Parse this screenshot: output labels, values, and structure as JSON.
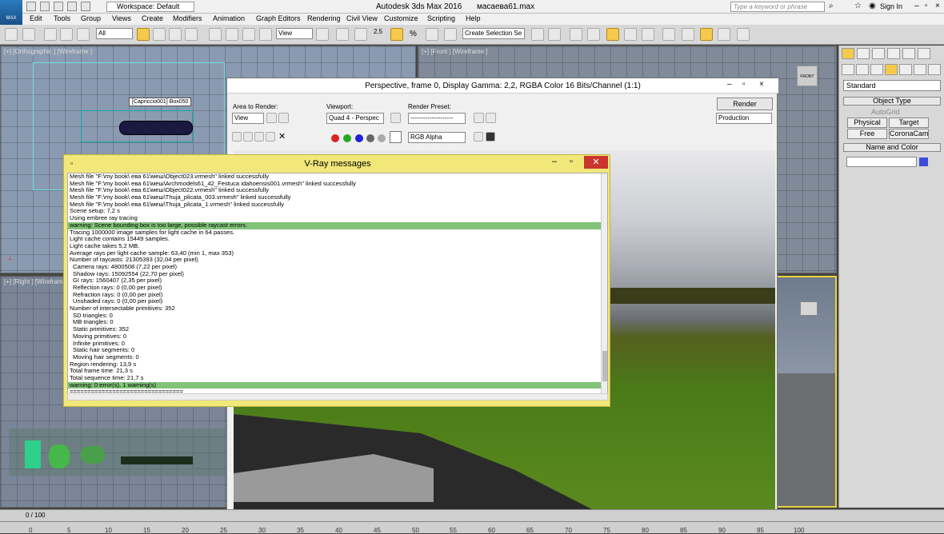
{
  "app": {
    "title": "Autodesk 3ds Max 2016",
    "filename": "масаева61.max",
    "workspace": "Workspace: Default",
    "search_placeholder": "Type a keyword or phrase",
    "sign_in": "Sign In",
    "logo_text": "MAX"
  },
  "menu": [
    "Edit",
    "Tools",
    "Group",
    "Views",
    "Create",
    "Modifiers",
    "Animation",
    "Graph Editors",
    "Rendering",
    "Civil View",
    "Customize",
    "Scripting",
    "Help"
  ],
  "toolbar": {
    "selection_filter": "All",
    "view_dropdown": "View",
    "selection_set": "Create Selection Se",
    "snap_value": "2.5",
    "percent_label": "%"
  },
  "viewports": {
    "ortho": "[+] [Orthographic ] [Wireframe ]",
    "front": "[+] [Front ] [Wireframe ]",
    "right": "[+] [Right ] [Wirefram",
    "tooltip": "[Capriccio001] Box050",
    "front_cube": "FRONT"
  },
  "command_panel": {
    "dropdown": "Standard",
    "object_type": "Object Type",
    "autogrid": "AutoGrid",
    "buttons": [
      "Physical",
      "Target",
      "Free",
      "CoronaCam"
    ],
    "name_and_color": "Name and Color"
  },
  "render_window": {
    "title": "Perspective, frame 0, Display Gamma: 2,2, RGBA Color 16 Bits/Channel (1:1)",
    "area_label": "Area to Render:",
    "area_value": "View",
    "viewport_label": "Viewport:",
    "viewport_value": "Quad 4 - Perspec",
    "preset_label": "Render Preset:",
    "preset_value": "--------------------",
    "render_button": "Render",
    "mode_value": "Production",
    "channel_value": "RGB Alpha"
  },
  "vray": {
    "title": "V-Ray messages",
    "lines": [
      {
        "t": "Mesh file \"F:\\my book\\              ева 61\\меш\\Object023.vrmesh\" linked successfully",
        "k": ""
      },
      {
        "t": "Mesh file \"F:\\my book\\              ева 61\\меш\\Archmodels61_42_Festuca idahoensis001.vrmesh\" linked successfully",
        "k": ""
      },
      {
        "t": "Mesh file \"F:\\my book\\              ева 61\\меш\\Object022.vrmesh\" linked successfully",
        "k": ""
      },
      {
        "t": "Mesh file \"F:\\my book\\              ева 61\\меш\\Thuja_plicata_003.vrmesh\" linked successfully",
        "k": ""
      },
      {
        "t": "Mesh file \"F:\\my book\\              ева 61\\меш\\Thuja_plicata_1.vrmesh\" linked successfully",
        "k": ""
      },
      {
        "t": "Scene setup: 7,2 s",
        "k": ""
      },
      {
        "t": "Using embree ray tracing",
        "k": ""
      },
      {
        "t": "warning: Scene bounding box is too large, possible raycast errors.",
        "k": "warn"
      },
      {
        "t": "Tracing 1000000 image samples for light cache in 64 passes.",
        "k": ""
      },
      {
        "t": "Light cache contains 15449 samples.",
        "k": ""
      },
      {
        "t": "Light cache takes 5,2 MB.",
        "k": ""
      },
      {
        "t": "Average rays per light cache sample: 63,40 (min 1, max 353)",
        "k": ""
      },
      {
        "t": "Number of raycasts: 21305393 (32,04 per pixel)",
        "k": ""
      },
      {
        "t": "Camera rays: 4800508 (7,22 per pixel)",
        "k": "ind"
      },
      {
        "t": "Shadow rays: 15092554 (22,70 per pixel)",
        "k": "ind"
      },
      {
        "t": "GI rays: 1560407 (2,35 per pixel)",
        "k": "ind"
      },
      {
        "t": "Reflection rays: 0 (0,00 per pixel)",
        "k": "ind"
      },
      {
        "t": "Refraction rays: 0 (0,00 per pixel)",
        "k": "ind"
      },
      {
        "t": "Unshaded rays: 0 (0,00 per pixel)",
        "k": "ind"
      },
      {
        "t": "Number of intersectable primitives: 352",
        "k": ""
      },
      {
        "t": "SD triangles: 0",
        "k": "ind"
      },
      {
        "t": "MB triangles: 0",
        "k": "ind"
      },
      {
        "t": "Static primitives: 352",
        "k": "ind"
      },
      {
        "t": "Moving primitives: 0",
        "k": "ind"
      },
      {
        "t": "Infinite primitives: 0",
        "k": "ind"
      },
      {
        "t": "Static hair segments: 0",
        "k": "ind"
      },
      {
        "t": "Moving hair segments: 0",
        "k": "ind"
      },
      {
        "t": "Region rendering: 13,9 s",
        "k": ""
      },
      {
        "t": "Total frame time: 21,3 s",
        "k": ""
      },
      {
        "t": "Total sequence time: 21,7 s",
        "k": ""
      },
      {
        "t": "warning: 0 error(s), 1 warning(s)",
        "k": "warn"
      },
      {
        "t": "================================",
        "k": ""
      }
    ]
  },
  "timeline": {
    "frame": "0 / 100",
    "ticks": [
      "0",
      "5",
      "10",
      "15",
      "20",
      "25",
      "30",
      "35",
      "40",
      "45",
      "50",
      "55",
      "60",
      "65",
      "70",
      "75",
      "80",
      "85",
      "90",
      "95",
      "100"
    ]
  }
}
